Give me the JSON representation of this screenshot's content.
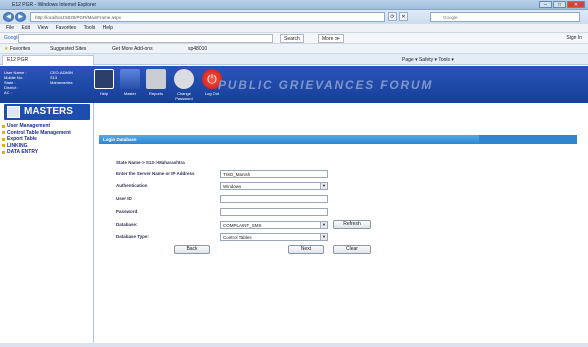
{
  "window": {
    "title": "E12 PGR - Windows Internet Explorer",
    "buttons": [
      "–",
      "□",
      "✕"
    ]
  },
  "address": {
    "url": "http://localhost:5020/PGR/MainFrame.aspx",
    "search_placeholder": "Google"
  },
  "menu": [
    "File",
    "Edit",
    "View",
    "Favorites",
    "Tools",
    "Help"
  ],
  "google": {
    "label": "Google",
    "search_btn": "Search",
    "more": "More ≫",
    "signin": "Sign In"
  },
  "favorites": {
    "label": "Favorites",
    "suggested": "Suggested Sites",
    "addons": "Get More Add-ons",
    "item": "sp48010"
  },
  "tab": {
    "label": "E12 PGR"
  },
  "commandbar": {
    "text": "Page ▾  Safety ▾  Tools ▾"
  },
  "user": {
    "labels": [
      "User Name :",
      "Mobile No:",
      "State :",
      "District :",
      "AC :"
    ],
    "values": [
      "CEO-ADMIN",
      "S13",
      "Maharashtra",
      "",
      ""
    ]
  },
  "toolbar": [
    {
      "label": "Help",
      "color": "#2b3f6b"
    },
    {
      "label": "Master",
      "color": "#3a63c8"
    },
    {
      "label": "Reports",
      "color": "#c9ccd3"
    },
    {
      "label": "Change Password",
      "color": "#d9dde2"
    },
    {
      "label": "Log Out",
      "color": "#d6201a"
    }
  ],
  "brand": "PUBLIC GRIEVANCES FORUM",
  "sidebar": {
    "title": "MASTERS",
    "items": [
      "User Management",
      "Control Table Management",
      "Export Table",
      "LINKING",
      "DATA ENTRY"
    ]
  },
  "form": {
    "header": "Login Database",
    "state": "State Name-> S13->Maharashtra",
    "server_label": "Enter the Server Name or IP Address",
    "server_value": "TISD_Manish",
    "auth_label": "Authentication",
    "auth_value": "Windows",
    "userid_label": "User ID",
    "password_label": "Password",
    "database_label": "Database:",
    "database_value": "COMPLAINT_SMS",
    "refresh_btn": "Refresh",
    "dbtype_label": "Database Type:",
    "dbtype_value": "Control Tables",
    "back_btn": "Back",
    "next_btn": "Next",
    "clear_btn": "Clear"
  }
}
